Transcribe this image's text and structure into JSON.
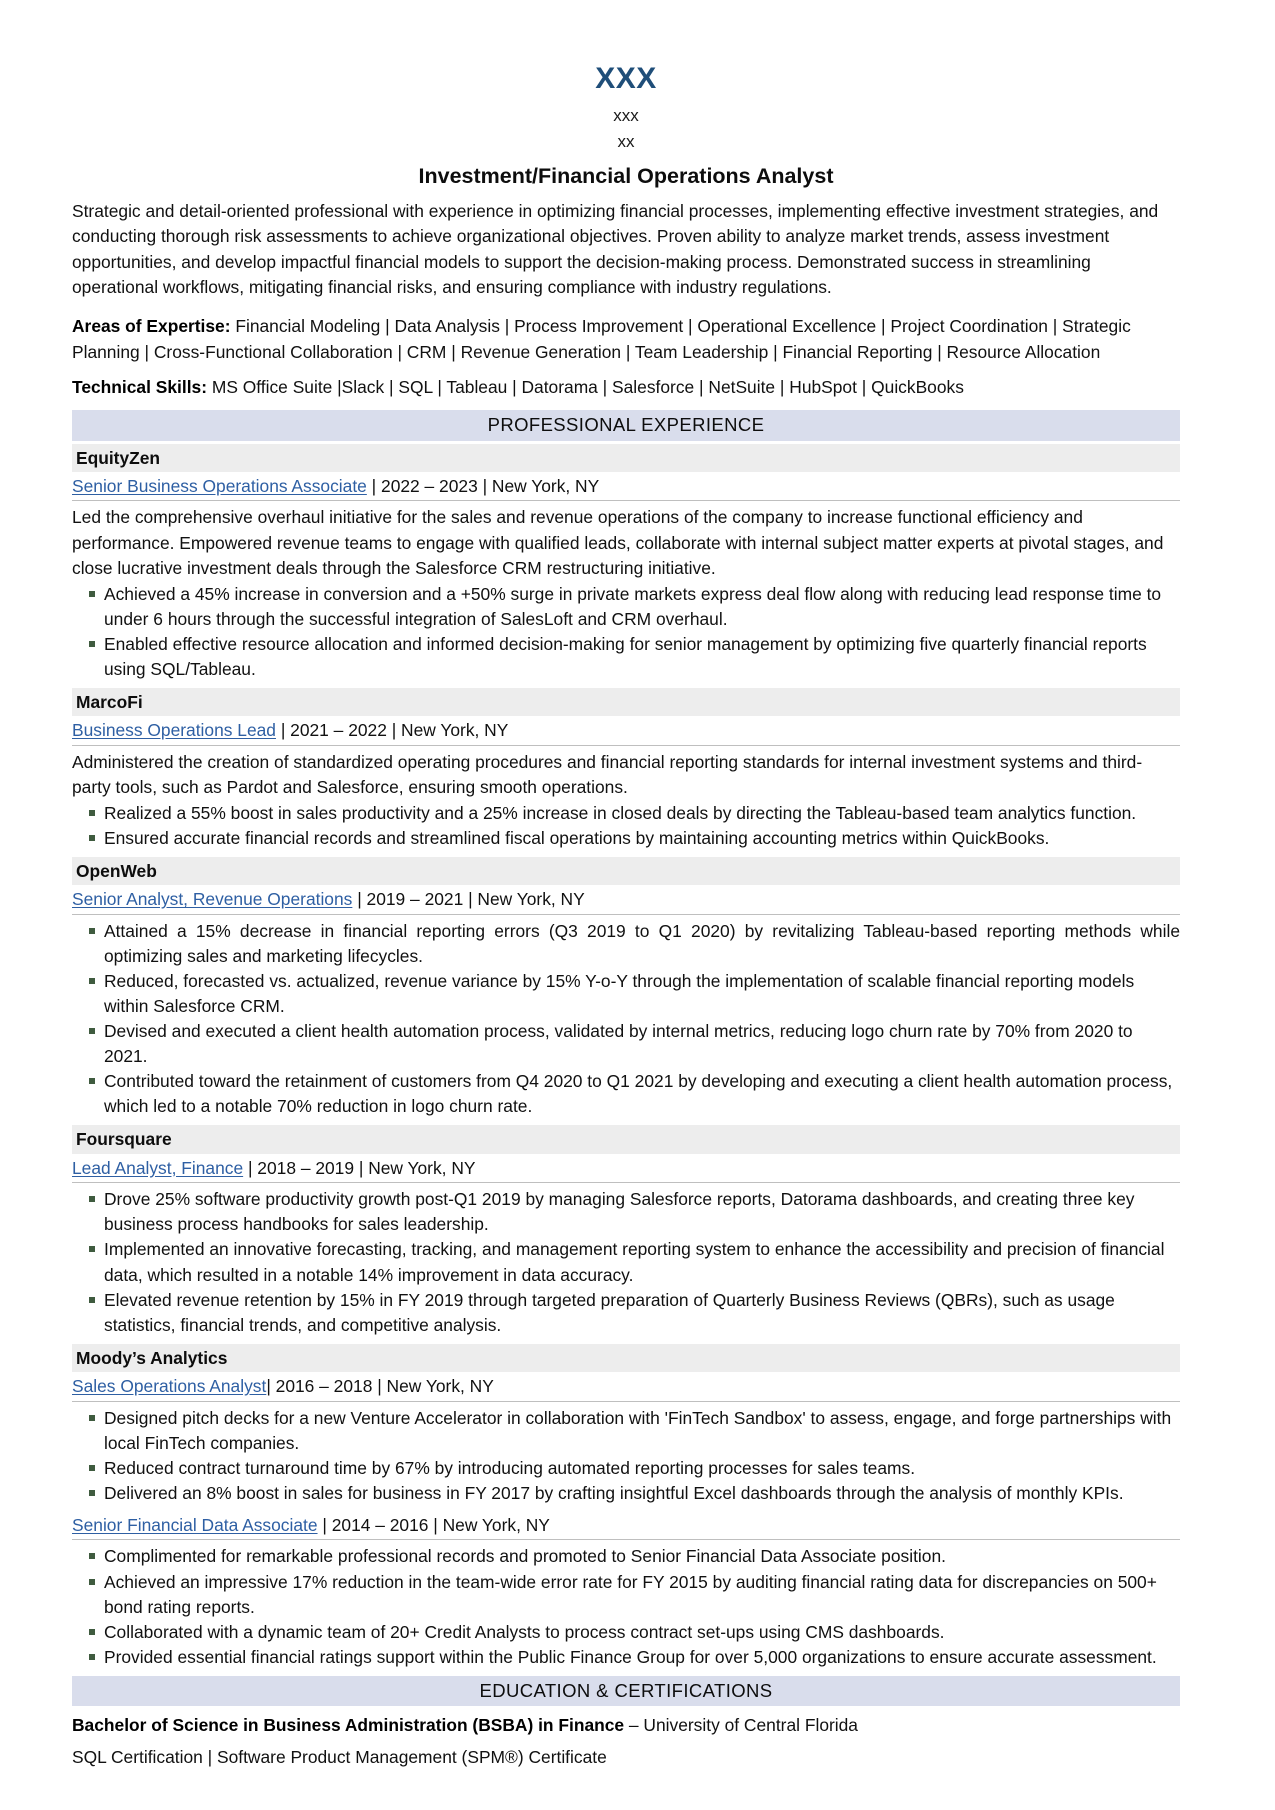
{
  "colors": {
    "name_blue": "#1F4E79",
    "role_blue": "#2E5FA3",
    "section_banner_bg": "#D9DDEC",
    "company_bg": "#EDEDED",
    "bullet": "#3F5B3F",
    "rule": "#BFBFBF"
  },
  "header": {
    "name": "XXX",
    "contact_line_1": "xxx",
    "contact_line_2": "xx",
    "headline": "Investment/Financial Operations Analyst",
    "summary": "Strategic and detail-oriented professional with experience in optimizing financial processes, implementing effective investment strategies, and conducting thorough risk assessments to achieve organizational objectives. Proven ability to analyze market trends, assess investment opportunities, and develop impactful financial models to support the decision-making process. Demonstrated success in streamlining operational workflows, mitigating financial risks, and ensuring compliance with industry regulations."
  },
  "expertise": {
    "label": "Areas of Expertise:",
    "value": " Financial Modeling | Data Analysis | Process Improvement | Operational Excellence | Project Coordination | Strategic Planning | Cross-Functional Collaboration | CRM | Revenue Generation | Team Leadership | Financial Reporting | Resource Allocation"
  },
  "technical_skills": {
    "label": "Technical Skills:",
    "value": " MS Office Suite |Slack | SQL | Tableau | Datorama | Salesforce | NetSuite | HubSpot | QuickBooks"
  },
  "sections": {
    "experience_title": "PROFESSIONAL EXPERIENCE",
    "education_title": "EDUCATION & CERTIFICATIONS"
  },
  "experience": [
    {
      "company": "EquityZen",
      "roles": [
        {
          "title": "Senior Business Operations Associate",
          "meta": " | 2022 – 2023 | New York, NY",
          "description": "Led the comprehensive overhaul initiative for the sales and revenue operations of the company to increase functional efficiency and performance. Empowered revenue teams to engage with qualified leads, collaborate with internal subject matter experts at pivotal stages, and close lucrative investment deals through the Salesforce CRM restructuring initiative.",
          "bullets": [
            "Achieved a 45% increase in conversion and a +50% surge in private markets express deal flow along with reducing lead response time to under 6 hours through the successful integration of SalesLoft and CRM overhaul.",
            "Enabled effective resource allocation and informed decision-making for senior management by optimizing five quarterly financial reports using SQL/Tableau."
          ]
        }
      ]
    },
    {
      "company": "MarcoFi",
      "roles": [
        {
          "title": "Business Operations Lead",
          "meta": " | 2021 – 2022 | New York, NY",
          "description": "Administered the creation of standardized operating procedures and financial reporting standards for internal investment systems and third-party tools, such as Pardot and Salesforce, ensuring smooth operations.",
          "bullets": [
            "Realized a 55% boost in sales productivity and a 25% increase in closed deals by directing the Tableau-based team analytics function.",
            "Ensured accurate financial records and streamlined fiscal operations by maintaining accounting metrics within QuickBooks."
          ]
        }
      ]
    },
    {
      "company": "OpenWeb",
      "roles": [
        {
          "title": "Senior Analyst, Revenue Operations",
          "meta": " | 2019 – 2021 | New York, NY",
          "description": "",
          "bullets": [
            "Attained a 15% decrease in financial reporting errors (Q3 2019 to Q1 2020) by revitalizing Tableau-based reporting methods while optimizing sales and marketing lifecycles.",
            "Reduced, forecasted vs. actualized, revenue variance by 15% Y-o-Y through the implementation of scalable financial reporting models within Salesforce CRM.",
            "Devised and executed a client health automation process, validated by internal metrics, reducing logo churn rate by 70% from 2020 to 2021.",
            "Contributed toward the retainment of customers from Q4 2020 to Q1 2021 by developing and executing a client health automation process, which led to a notable 70% reduction in logo churn rate."
          ]
        }
      ]
    },
    {
      "company": "Foursquare",
      "roles": [
        {
          "title": "Lead Analyst, Finance",
          "meta": " | 2018 – 2019 | New York, NY",
          "description": "",
          "bullets": [
            "Drove 25% software productivity growth post-Q1 2019 by managing Salesforce reports, Datorama dashboards, and creating three key business process handbooks for sales leadership.",
            "Implemented an innovative forecasting, tracking, and management reporting system to enhance the accessibility and precision of financial data, which resulted in a notable 14% improvement in data accuracy.",
            "Elevated revenue retention by 15% in FY 2019 through targeted preparation of Quarterly Business Reviews (QBRs), such as usage statistics, financial trends, and competitive analysis."
          ]
        }
      ]
    },
    {
      "company": "Moody’s Analytics",
      "roles": [
        {
          "title": "Sales Operations Analyst",
          "meta": "| 2016 – 2018 | New York, NY",
          "description": "",
          "bullets": [
            "Designed pitch decks for a new Venture Accelerator in collaboration with 'FinTech Sandbox' to assess, engage, and forge partnerships with local FinTech companies.",
            "Reduced contract turnaround time by 67% by introducing automated reporting processes for sales teams.",
            "Delivered an 8% boost in sales for business in FY 2017 by crafting insightful Excel dashboards through the analysis of monthly KPIs."
          ]
        },
        {
          "title": "Senior Financial Data Associate",
          "meta": " | 2014 – 2016 | New York, NY",
          "description": "",
          "bullets": [
            "Complimented for remarkable professional records and promoted to Senior Financial Data Associate position.",
            "Achieved an impressive 17% reduction in the team-wide error rate for FY 2015 by auditing financial rating data for discrepancies on 500+ bond rating reports.",
            "Collaborated with a dynamic team of 20+ Credit Analysts to process contract set-ups using CMS dashboards.",
            "Provided essential financial ratings support within the Public Finance Group for over 5,000 organizations to ensure accurate assessment."
          ]
        }
      ]
    }
  ],
  "education": {
    "degree": "Bachelor of Science in Business Administration (BSBA) in Finance",
    "institution": " – University of Central Florida",
    "certifications": "SQL Certification | Software Product Management (SPM®) Certificate"
  }
}
